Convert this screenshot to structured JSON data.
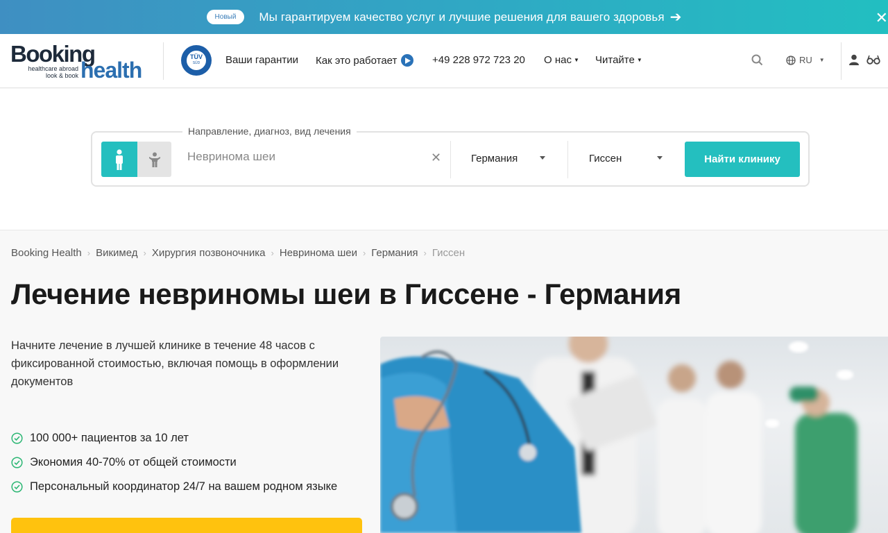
{
  "banner": {
    "badge": "Новый",
    "text": "Мы гарантируем качество услуг и лучшие решения для вашего здоровья"
  },
  "header": {
    "logo_main": "Booking",
    "logo_sub": "health",
    "logo_tag": "healthcare abroad look & book",
    "tuv_text": "TÜV",
    "tuv_sub": "SÜD",
    "nav": {
      "guarantees": "Ваши гарантии",
      "how_it_works": "Как это работает",
      "phone": "+49 228 972 723 20",
      "about": "О нас",
      "read": "Читайте"
    },
    "lang": "RU"
  },
  "search": {
    "legend": "Направление, диагноз, вид лечения",
    "diagnosis_value": "Невринома шеи",
    "country": "Германия",
    "city": "Гиссен",
    "button": "Найти клинику"
  },
  "breadcrumb": [
    "Booking Health",
    "Викимед",
    "Хирургия позвоночника",
    "Невринома шеи",
    "Германия",
    "Гиссен"
  ],
  "title": "Лечение невриномы шеи в Гиссене - Германия",
  "intro": "Начните лечение в лучшей клинике в течение 48 часов с фиксированной стоимостью, включая помощь в оформлении документов",
  "benefits": [
    "100 000+ пациентов за 10 лет",
    "Экономия 40-70% от общей стоимости",
    "Персональный координатор 24/7 на вашем родном языке"
  ],
  "colors": {
    "accent": "#24bfbf",
    "brand_blue": "#2c6fb0",
    "cta": "#ffc20e"
  }
}
